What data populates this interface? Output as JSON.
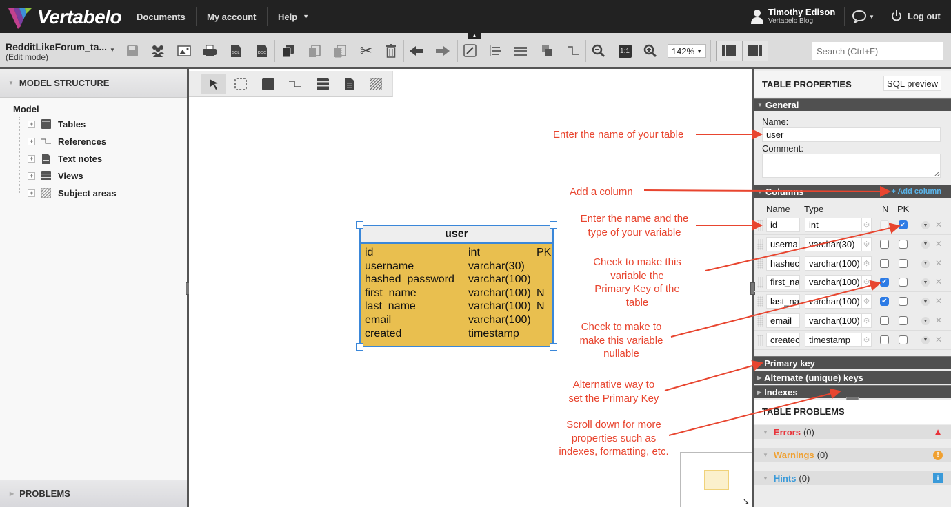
{
  "nav": {
    "logo_text": "Vertabelo",
    "links": [
      "Documents",
      "My account",
      "Help"
    ],
    "user_name": "Timothy Edison",
    "user_sub": "Vertabelo Blog",
    "logout": "Log out"
  },
  "toolbar": {
    "doc_name": "RedditLikeForum_ta...",
    "doc_mode": "(Edit mode)",
    "icons": [
      "save-icon",
      "share-users-icon",
      "export-image-icon",
      "print-icon",
      "sql-export-icon",
      "doc-export-icon",
      "copy-icon",
      "paste-icon",
      "paste-special-icon",
      "cut-icon",
      "delete-icon",
      "undo-icon",
      "redo-icon",
      "format-icon",
      "align-icon",
      "distribute-icon",
      "arrange-icon",
      "reference-style-icon",
      "zoom-out-icon",
      "zoom-reset-icon",
      "zoom-in-icon"
    ],
    "zoom_level": "142%",
    "search_placeholder": "Search (Ctrl+F)"
  },
  "left_panel": {
    "title": "MODEL STRUCTURE",
    "root": "Model",
    "items": [
      "Tables",
      "References",
      "Text notes",
      "Views",
      "Subject areas"
    ],
    "footer": "PROBLEMS"
  },
  "palette": [
    "select-tool",
    "area-select-tool",
    "add-table-tool",
    "add-reference-tool",
    "add-view-tool",
    "add-note-tool",
    "add-subject-area-tool"
  ],
  "entity": {
    "name": "user",
    "columns": [
      {
        "name": "id",
        "type": "int",
        "flag": "PK"
      },
      {
        "name": "username",
        "type": "varchar(30)",
        "flag": ""
      },
      {
        "name": "hashed_password",
        "type": "varchar(100)",
        "flag": ""
      },
      {
        "name": "first_name",
        "type": "varchar(100)",
        "flag": "N"
      },
      {
        "name": "last_name",
        "type": "varchar(100)",
        "flag": "N"
      },
      {
        "name": "email",
        "type": "varchar(100)",
        "flag": ""
      },
      {
        "name": "created",
        "type": "timestamp",
        "flag": ""
      }
    ],
    "fill_color": "#e9bf4f",
    "border_color": "#3a87d9"
  },
  "annotations": {
    "color": "#e8452f",
    "table_name": "Enter the name of your table",
    "add_column": "Add a column",
    "name_type_1": "Enter the name and the",
    "name_type_2": "type of your variable",
    "pk_1": "Check to make this",
    "pk_2": "variable the",
    "pk_3": "Primary Key of the",
    "pk_4": "table",
    "null_1": "Check to make to",
    "null_2": "make this variable",
    "null_3": "nullable",
    "alt_1": "Alternative way to",
    "alt_2": "set the Primary Key",
    "scroll_1": "Scroll down for more",
    "scroll_2": "properties such as",
    "scroll_3": "indexes, formatting, etc."
  },
  "right_panel": {
    "title": "TABLE PROPERTIES",
    "sql_preview": "SQL preview",
    "general": "General",
    "name_label": "Name:",
    "name_value": "user",
    "comment_label": "Comment:",
    "comment_value": "",
    "columns_section": "Columns",
    "add_column": "+ Add column",
    "col_headers": {
      "name": "Name",
      "type": "Type",
      "n": "N",
      "pk": "PK"
    },
    "rows": [
      {
        "name": "id",
        "type": "int",
        "nullable": false,
        "pk": true,
        "n_disabled": true
      },
      {
        "name": "userna",
        "type": "varchar(30)",
        "nullable": false,
        "pk": false
      },
      {
        "name": "hashec",
        "type": "varchar(100)",
        "nullable": false,
        "pk": false
      },
      {
        "name": "first_na",
        "type": "varchar(100)",
        "nullable": true,
        "pk": false
      },
      {
        "name": "last_na",
        "type": "varchar(100)",
        "nullable": true,
        "pk": false
      },
      {
        "name": "email",
        "type": "varchar(100)",
        "nullable": false,
        "pk": false
      },
      {
        "name": "createc",
        "type": "timestamp",
        "nullable": false,
        "pk": false
      }
    ],
    "sections": [
      "Primary key",
      "Alternate (unique) keys",
      "Indexes"
    ],
    "problems_title": "TABLE PROBLEMS",
    "problems": [
      {
        "label": "Errors",
        "count": "(0)",
        "color": "#e8333a"
      },
      {
        "label": "Warnings",
        "count": "(0)",
        "color": "#f0a030"
      },
      {
        "label": "Hints",
        "count": "(0)",
        "color": "#3a9ad9"
      }
    ]
  }
}
